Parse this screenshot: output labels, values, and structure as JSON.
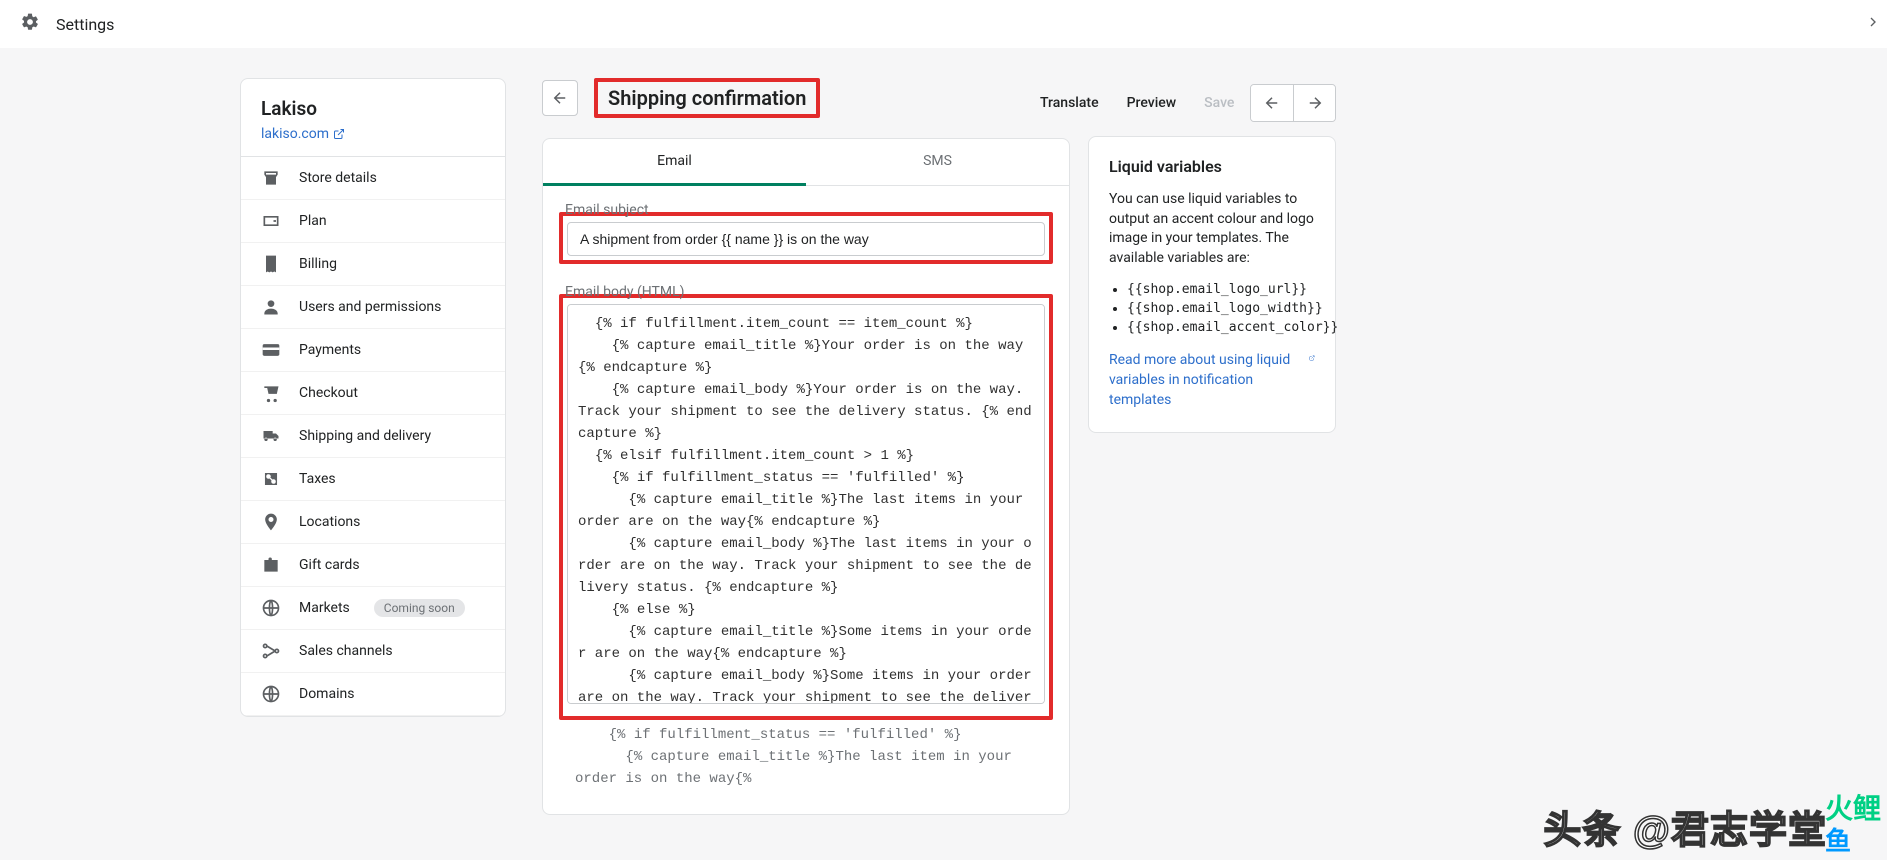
{
  "top": {
    "title": "Settings"
  },
  "store": {
    "name": "Lakiso",
    "url": "lakiso.com"
  },
  "sidebar": {
    "items": [
      {
        "label": "Store details"
      },
      {
        "label": "Plan"
      },
      {
        "label": "Billing"
      },
      {
        "label": "Users and permissions"
      },
      {
        "label": "Payments"
      },
      {
        "label": "Checkout"
      },
      {
        "label": "Shipping and delivery"
      },
      {
        "label": "Taxes"
      },
      {
        "label": "Locations"
      },
      {
        "label": "Gift cards"
      },
      {
        "label": "Markets",
        "badge": "Coming soon"
      },
      {
        "label": "Sales channels"
      },
      {
        "label": "Domains"
      }
    ]
  },
  "header": {
    "page_title": "Shipping confirmation",
    "translate": "Translate",
    "preview": "Preview",
    "save": "Save"
  },
  "tabs": {
    "email": "Email",
    "sms": "SMS"
  },
  "form": {
    "subject_label": "Email subject",
    "subject_value": "A shipment from order {{ name }} is on the way",
    "body_label": "Email body (HTML)",
    "body_value": "  {% if fulfillment.item_count == item_count %}\n    {% capture email_title %}Your order is on the way{% endcapture %}\n    {% capture email_body %}Your order is on the way. Track your shipment to see the delivery status. {% endcapture %}\n  {% elsif fulfillment.item_count > 1 %}\n    {% if fulfillment_status == 'fulfilled' %}\n      {% capture email_title %}The last items in your order are on the way{% endcapture %}\n      {% capture email_body %}The last items in your order are on the way. Track your shipment to see the delivery status. {% endcapture %}\n    {% else %}\n      {% capture email_title %}Some items in your order are on the way{% endcapture %}\n      {% capture email_body %}Some items in your order are on the way. Track your shipment to see the delivery status. {% endcapture %}\n    {% endif %}\n  {% else %}",
    "body_extra": "    {% if fulfillment_status == 'fulfilled' %}\n      {% capture email_title %}The last item in your order is on the way{%"
  },
  "info": {
    "title": "Liquid variables",
    "text": "You can use liquid variables to output an accent colour and logo image in your templates. The available variables are:",
    "vars": [
      "{{shop.email_logo_url}}",
      "{{shop.email_logo_width}}",
      "{{shop.email_accent_color}}"
    ],
    "link": "Read more about using liquid variables in notification templates"
  },
  "watermarks": {
    "w1": "头条 @君志学堂",
    "w2a": "火鲤",
    "w2b": "鱼"
  }
}
